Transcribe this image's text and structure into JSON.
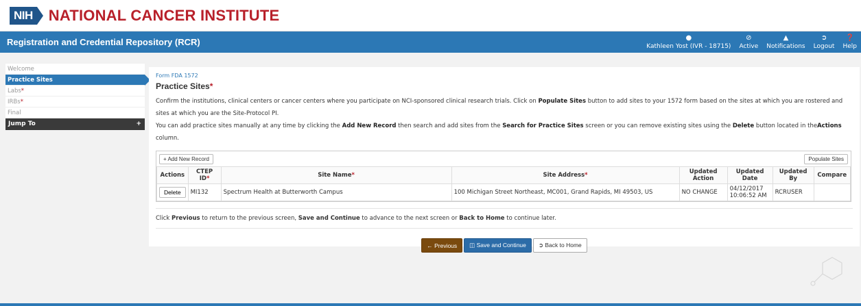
{
  "brand": {
    "nih": "NIH",
    "institute": "NATIONAL CANCER INSTITUTE"
  },
  "topbar": {
    "app_title": "Registration and Credential Repository (RCR)",
    "user": "Kathleen Yost (IVR - 18715)",
    "status": "Active",
    "notifications": "Notifications",
    "logout": "Logout",
    "help": "Help"
  },
  "sidebar": {
    "items": [
      {
        "label": "Welcome",
        "required": false
      },
      {
        "label": "Practice Sites",
        "required": false
      },
      {
        "label": "Labs",
        "required": true
      },
      {
        "label": "IRBs",
        "required": true
      },
      {
        "label": "Final",
        "required": false
      }
    ],
    "jump": "Jump To",
    "jump_icon": "+"
  },
  "main": {
    "crumb": "Form FDA 1572",
    "title": "Practice Sites",
    "para1_a": "Confirm the institutions, clinical centers or cancer centers where you participate on NCI-sponsored clinical research trials. Click on ",
    "para1_b": "Populate Sites",
    "para1_c": " button to add sites to your 1572 form based on the sites at which you are rostered and sites at which you are the Site-Protocol PI.",
    "para2_a": "You can add practice sites manually at any time by clicking the ",
    "para2_b": "Add New Record",
    "para2_c": " then search and add sites from the ",
    "para2_d": "Search for Practice Sites",
    "para2_e": " screen or you can remove existing sites using the ",
    "para2_f": "Delete",
    "para2_g": " button located in the",
    "para2_h": "Actions",
    "para2_i": " column.",
    "add_record": "Add New Record",
    "populate": "Populate Sites",
    "columns": {
      "actions": "Actions",
      "ctep": "CTEP ID",
      "site": "Site Name",
      "address": "Site Address",
      "action": "Updated Action",
      "date": "Updated Date",
      "by": "Updated By",
      "compare": "Compare"
    },
    "row": {
      "delete": "Delete",
      "ctep": "MI132",
      "site": "Spectrum Health at Butterworth Campus",
      "address": "100 Michigan Street Northeast, MC001, Grand Rapids, MI 49503, US",
      "action": "NO CHANGE",
      "date1": "04/12/2017",
      "date2": "10:06:52 AM",
      "by": "RCRUSER",
      "compare": ""
    },
    "foot_a": "Click ",
    "foot_b": "Previous",
    "foot_c": " to return to the previous screen, ",
    "foot_d": "Save and Continue",
    "foot_e": " to advance to the next screen or ",
    "foot_f": "Back to Home",
    "foot_g": " to continue later.",
    "btn_prev": "Previous",
    "btn_save": "Save and Continue",
    "btn_home": "Back to Home"
  },
  "colors": {
    "primary": "#2c78b5",
    "brand_red": "#b8202a",
    "prev_btn": "#7a4a0e"
  }
}
